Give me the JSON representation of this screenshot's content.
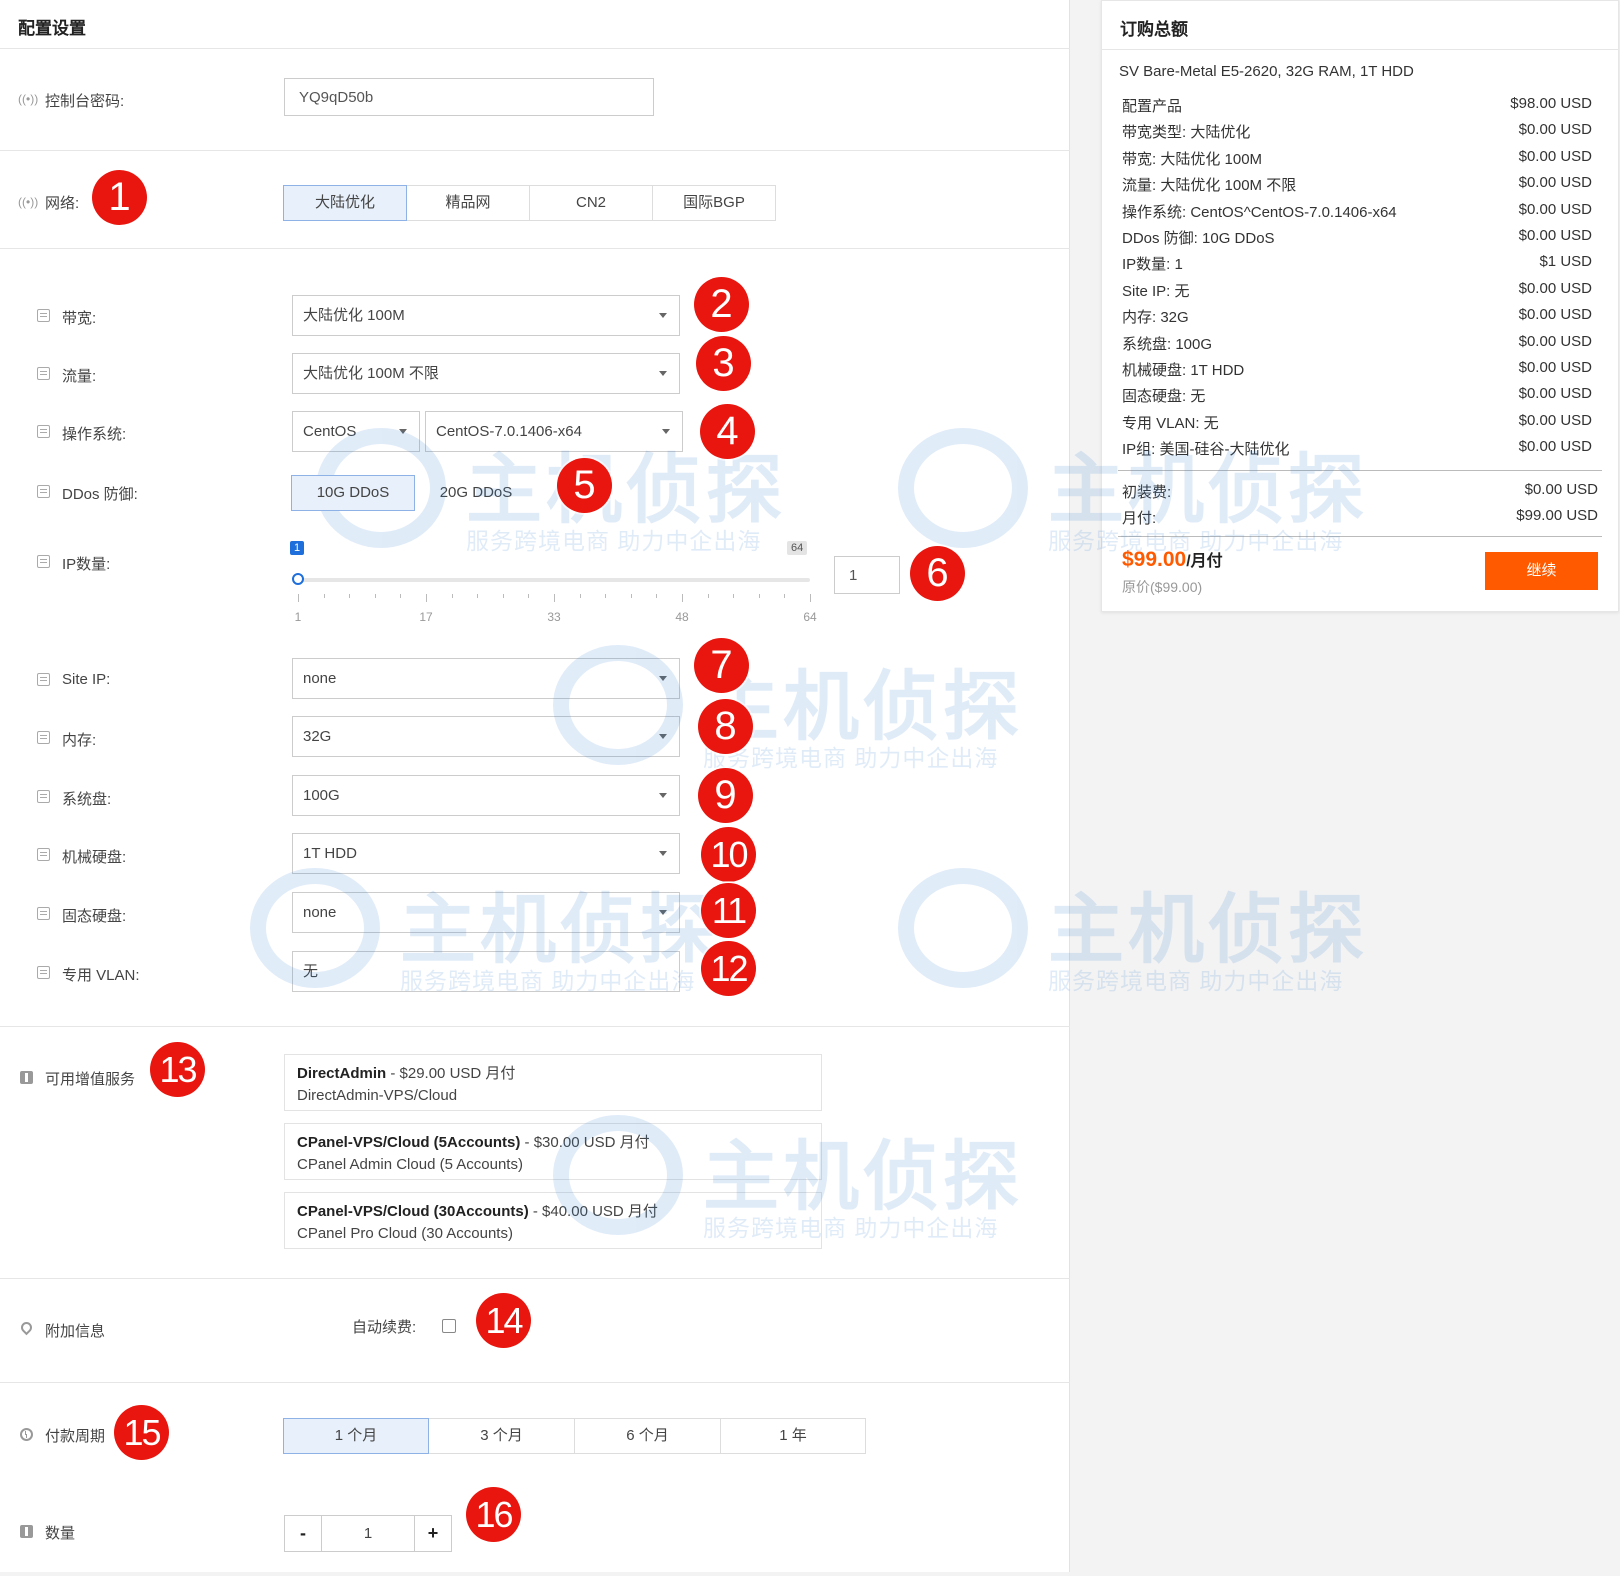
{
  "config": {
    "title": "配置设置",
    "password": {
      "label": "控制台密码:",
      "value": "YQ9qD50b"
    },
    "network": {
      "label": "网络:",
      "options": [
        "大陆优化",
        "精品网",
        "CN2",
        "国际BGP"
      ],
      "selected": "大陆优化"
    },
    "bandwidth": {
      "label": "带宽:",
      "value": "大陆优化 100M"
    },
    "traffic": {
      "label": "流量:",
      "value": "大陆优化 100M 不限"
    },
    "os": {
      "label": "操作系统:",
      "family": "CentOS",
      "version": "CentOS-7.0.1406-x64"
    },
    "ddos": {
      "label": "DDos 防御:",
      "options": [
        "10G DDoS",
        "20G DDoS"
      ],
      "selected": "10G DDoS"
    },
    "ip_count": {
      "label": "IP数量:",
      "min": 1,
      "max": 64,
      "value": 1,
      "min_label": "1",
      "max_label": "64",
      "ticks": [
        "1",
        "17",
        "33",
        "48",
        "64"
      ],
      "input_value": "1"
    },
    "site_ip": {
      "label": "Site IP:",
      "value": "none"
    },
    "memory": {
      "label": "内存:",
      "value": "32G"
    },
    "system_disk": {
      "label": "系统盘:",
      "value": "100G"
    },
    "hdd": {
      "label": "机械硬盘:",
      "value": "1T HDD"
    },
    "ssd": {
      "label": "固态硬盘:",
      "value": "none"
    },
    "vlan": {
      "label": "专用 VLAN:",
      "value": "无"
    }
  },
  "addons": {
    "label": "可用增值服务",
    "items": [
      {
        "name": "DirectAdmin",
        "price": " - $29.00 USD 月付",
        "desc": "DirectAdmin-VPS/Cloud"
      },
      {
        "name": "CPanel-VPS/Cloud (5Accounts)",
        "price": " - $30.00 USD 月付",
        "desc": "CPanel Admin Cloud (5 Accounts)"
      },
      {
        "name": "CPanel-VPS/Cloud (30Accounts)",
        "price": " - $40.00 USD 月付",
        "desc": "CPanel Pro Cloud (30 Accounts)"
      }
    ]
  },
  "extra": {
    "label": "附加信息",
    "auto_renew_label": "自动续费:",
    "auto_renew_checked": false
  },
  "billing": {
    "label": "付款周期",
    "options": [
      "1 个月",
      "3 个月",
      "6 个月",
      "1 年"
    ],
    "selected": "1 个月"
  },
  "quantity": {
    "label": "数量",
    "minus": "-",
    "value": "1",
    "plus": "+"
  },
  "summary": {
    "title": "订购总额",
    "product": "SV Bare-Metal E5-2620, 32G RAM, 1T HDD",
    "rows": [
      {
        "k": "配置产品",
        "v": "$98.00 USD"
      },
      {
        "k": "带宽类型: 大陆优化",
        "v": "$0.00 USD"
      },
      {
        "k": "带宽: 大陆优化 100M",
        "v": "$0.00 USD"
      },
      {
        "k": "流量: 大陆优化 100M 不限",
        "v": "$0.00 USD"
      },
      {
        "k": "操作系统: CentOS^CentOS-7.0.1406-x64",
        "v": "$0.00 USD"
      },
      {
        "k": "DDos 防御: 10G DDoS",
        "v": "$0.00 USD"
      },
      {
        "k": "IP数量: 1",
        "v": "$1 USD"
      },
      {
        "k": "Site IP: 无",
        "v": "$0.00 USD"
      },
      {
        "k": "内存: 32G",
        "v": "$0.00 USD"
      },
      {
        "k": "系统盘: 100G",
        "v": "$0.00 USD"
      },
      {
        "k": "机械硬盘: 1T HDD",
        "v": "$0.00 USD"
      },
      {
        "k": "固态硬盘: 无",
        "v": "$0.00 USD"
      },
      {
        "k": "专用 VLAN: 无",
        "v": "$0.00 USD"
      },
      {
        "k": "IP组: 美国-硅谷-大陆优化",
        "v": "$0.00 USD"
      }
    ],
    "setup": {
      "k": "初装费:",
      "v": "$0.00 USD"
    },
    "monthly": {
      "k": "月付:",
      "v": "$99.00 USD"
    },
    "total": "$99.00",
    "total_suffix": "/月付",
    "original": "原价($99.00)",
    "continue": "继续"
  },
  "badges": [
    "1",
    "2",
    "3",
    "4",
    "5",
    "6",
    "7",
    "8",
    "9",
    "10",
    "11",
    "12",
    "13",
    "14",
    "15",
    "16"
  ],
  "watermark": {
    "brand": "主机侦探",
    "slogan": "服务跨境电商 助力中企出海"
  },
  "colors": {
    "accent": "#1e6fdc",
    "price": "#ff5a00",
    "badge": "#e8160e",
    "active_seg": "#e8f0fb"
  }
}
